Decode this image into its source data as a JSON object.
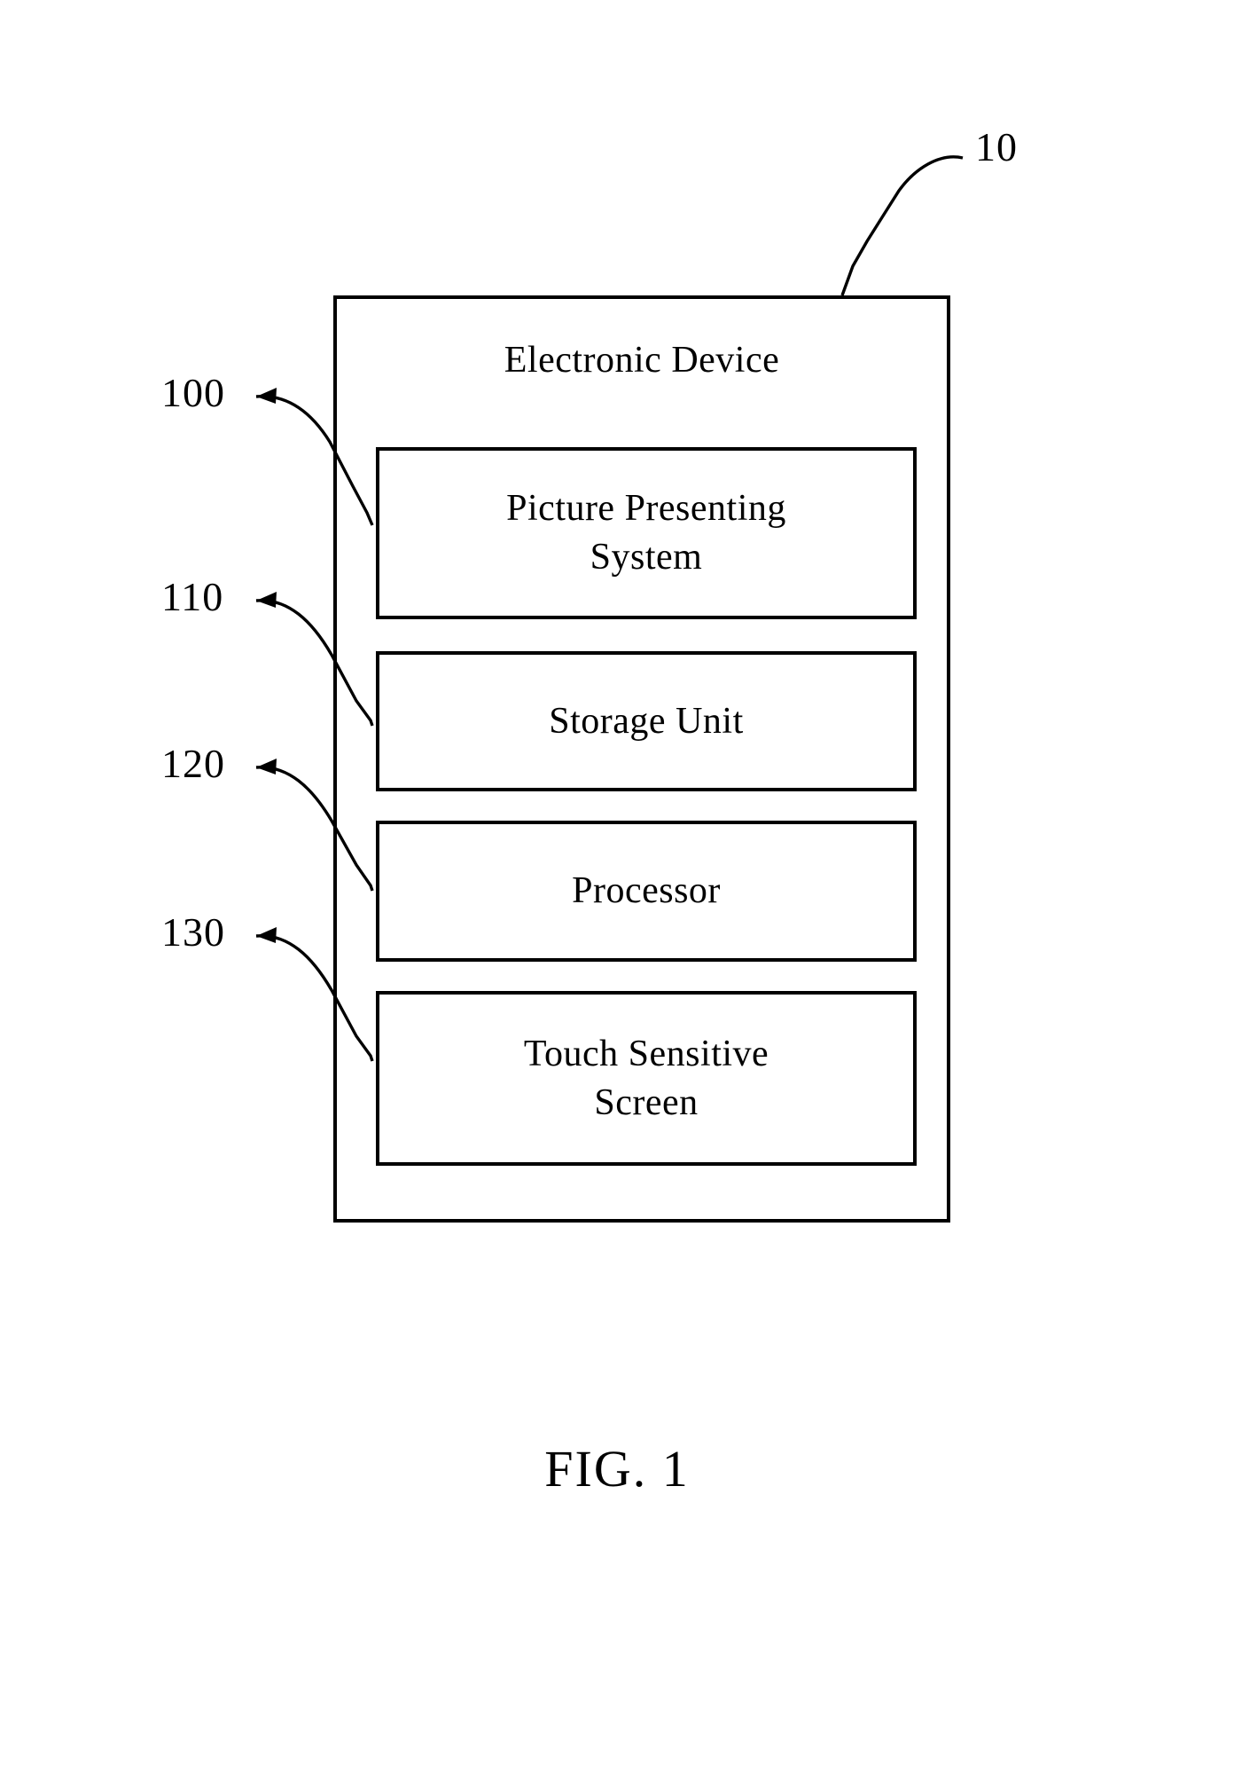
{
  "figure": {
    "caption": "FIG. 1",
    "outer_block": {
      "title": "Electronic Device",
      "reference_numeral": "10"
    },
    "blocks": [
      {
        "label_line1": "Picture Presenting",
        "label_line2": "System",
        "reference_numeral": "100"
      },
      {
        "label_line1": "Storage Unit",
        "label_line2": "",
        "reference_numeral": "110"
      },
      {
        "label_line1": "Processor",
        "label_line2": "",
        "reference_numeral": "120"
      },
      {
        "label_line1": "Touch Sensitive",
        "label_line2": "Screen",
        "reference_numeral": "130"
      }
    ]
  },
  "colors": {
    "background": "#ffffff",
    "line": "#000000",
    "text": "#000000"
  }
}
